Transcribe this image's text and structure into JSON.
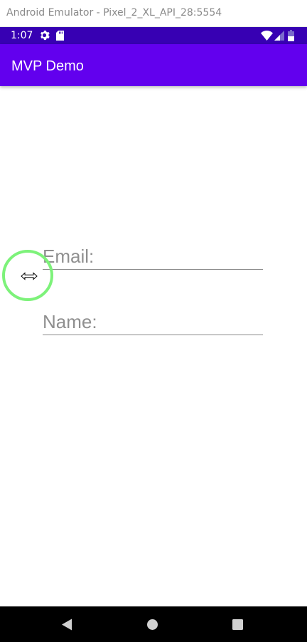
{
  "window": {
    "title": "Android Emulator - Pixel_2_XL_API_28:5554"
  },
  "status_bar": {
    "time": "1:07",
    "icons": [
      "gear-icon",
      "sd-card-icon",
      "wifi-icon",
      "signal-icon",
      "battery-icon"
    ],
    "color": "#3700b3"
  },
  "app_bar": {
    "title": "MVP Demo",
    "color": "#6200ee"
  },
  "form": {
    "email": {
      "placeholder": "Email:",
      "value": ""
    },
    "name": {
      "placeholder": "Name:",
      "value": ""
    }
  },
  "overlay": {
    "touch_indicator_color": "#7df27a",
    "cursor": "resize-horizontal-icon"
  },
  "nav_bar": {
    "icons": [
      "back-icon",
      "home-icon",
      "recents-icon"
    ]
  }
}
